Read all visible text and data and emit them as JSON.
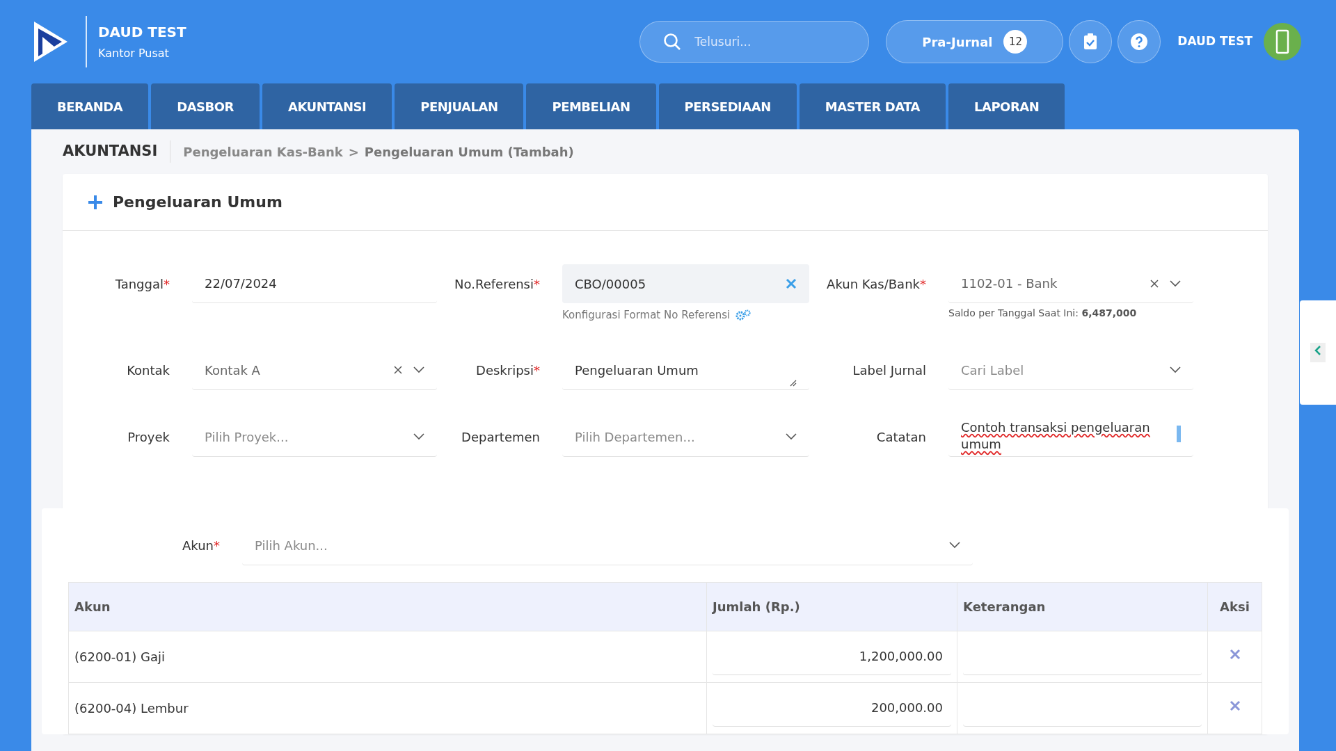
{
  "brand": {
    "title": "DAUD TEST",
    "subtitle": "Kantor Pusat"
  },
  "search": {
    "placeholder": "Telusuri..."
  },
  "pra_jurnal": {
    "label": "Pra-Jurnal",
    "count": "12"
  },
  "user": {
    "name": "DAUD TEST"
  },
  "nav_tabs": [
    {
      "label": "BERANDA"
    },
    {
      "label": "DASBOR"
    },
    {
      "label": "AKUNTANSI"
    },
    {
      "label": "PENJUALAN"
    },
    {
      "label": "PEMBELIAN"
    },
    {
      "label": "PERSEDIAAN"
    },
    {
      "label": "MASTER DATA"
    },
    {
      "label": "LAPORAN"
    }
  ],
  "breadcrumb": {
    "section": "AKUNTANSI",
    "items": [
      {
        "label": "Pengeluaran Kas-Bank",
        "current": false
      },
      {
        "label": ">",
        "current": false
      },
      {
        "label": "Pengeluaran Umum (Tambah)",
        "current": true
      }
    ]
  },
  "form_title": "Pengeluaran Umum",
  "fields": [
    {
      "kind": "input",
      "label": "Tanggal",
      "mark": "*",
      "value": "22/07/2024"
    },
    {
      "kind": "ref",
      "label": "No.Referensi",
      "mark": "*",
      "value": "CBO/00005",
      "hint": "Konfigurasi Format No Referensi"
    },
    {
      "kind": "select",
      "label": "Akun Kas/Bank",
      "mark": "*",
      "value": "1102-01 - Bank",
      "clearable": true,
      "hint": "Saldo per Tanggal Saat Ini: **6,487,000**"
    },
    {
      "kind": "select",
      "label": "Kontak",
      "value": "Kontak A",
      "clearable": true
    },
    {
      "kind": "textarea",
      "label": "Deskripsi",
      "mark": "*",
      "value": "Pengeluaran Umum"
    },
    {
      "kind": "select",
      "label": "Label Jurnal",
      "placeholder": "Cari Label",
      "clearable": false
    },
    {
      "kind": "select",
      "label": "Proyek",
      "placeholder": "Pilih Proyek...",
      "clearable": false
    },
    {
      "kind": "select",
      "label": "Departemen",
      "placeholder": "Pilih Departemen...",
      "clearable": false
    },
    {
      "kind": "notes",
      "label": "Catatan",
      "value": "Contoh transaksi pengeluaran umum"
    }
  ],
  "akun_select": {
    "label": "Akun",
    "mark": "*",
    "placeholder": "Pilih Akun..."
  },
  "table": {
    "columns": [
      "Akun",
      "Jumlah (Rp.)",
      "Keterangan",
      "Aksi"
    ],
    "rows": [
      {
        "akun": "(6200-01) Gaji",
        "jumlah": "1,200,000.00"
      },
      {
        "akun": "(6200-04) Lembur",
        "jumlah": "200,000.00"
      }
    ]
  }
}
